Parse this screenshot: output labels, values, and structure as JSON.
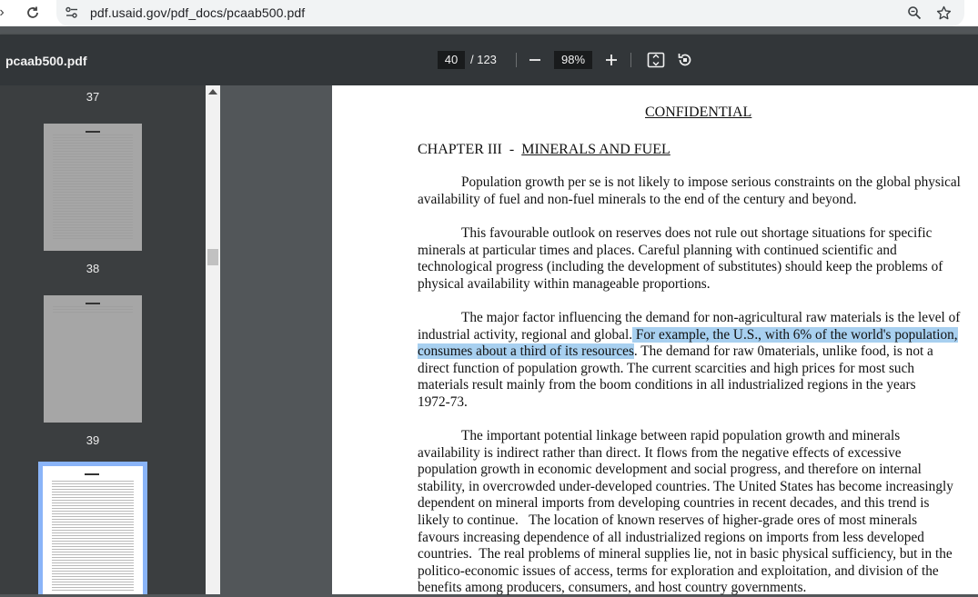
{
  "browser": {
    "url": "pdf.usaid.gov/pdf_docs/pcaab500.pdf"
  },
  "toolbar": {
    "filename": "pcaab500.pdf",
    "current_page": "40",
    "page_total": "/ 123",
    "zoom": "98%"
  },
  "sidebar": {
    "labels": [
      "37",
      "38",
      "39"
    ]
  },
  "document": {
    "confidential": "CONFIDENTIAL",
    "chapter_prefix": "CHAPTER III  -  ",
    "chapter_title": "MINERALS AND FUEL",
    "para1": [
      "Population growth per se is not likely to impose serious constraints on the global physical",
      "availability of fuel and non-fuel minerals to the end of the century and beyond."
    ],
    "para2": [
      "This favourable outlook on reserves does not rule out shortage situations for specific",
      "minerals at particular times and places. Careful planning with continued scientific and",
      "technological progress (including the development of substitutes) should keep the problems of",
      "physical availability within manageable proportions."
    ],
    "para3": {
      "line1": "The major factor influencing the demand for non-agricultural raw materials is the level of",
      "line2_plain": "industrial activity, regional and global.",
      "line2_hl": " For example, the U.S., with 6% of the world's population,",
      "line3_hl": "consumes about a third of its resources",
      "line3_plain": ". The demand for raw 0materials, unlike food, is not a",
      "rest": [
        "direct function of population growth. The current scarcities and high prices for most such",
        "materials result mainly from the boom conditions in all industrialized regions in the years",
        "1972-73."
      ]
    },
    "para4": [
      "The important potential linkage between rapid population growth and minerals",
      "availability is indirect rather than direct. It flows from the negative effects of excessive",
      "population growth in economic development and social progress, and therefore on internal",
      "stability, in overcrowded under-developed countries. The United States has become increasingly",
      "dependent on mineral imports from developing countries in recent decades, and this trend is",
      "likely to continue.   The location of known reserves of higher-grade ores of most minerals",
      "favours increasing dependence of all industrialized regions on imports from less developed",
      "countries.  The real problems of mineral supplies lie, not in basic physical sufficiency, but in the",
      "politico-economic issues of access, terms for exploration and exploitation, and division of the",
      "benefits among producers, consumers, and host country governments."
    ]
  }
}
